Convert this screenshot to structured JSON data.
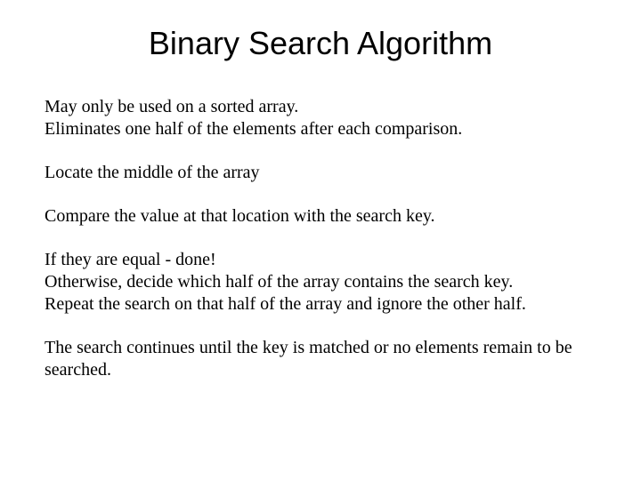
{
  "title": "Binary Search Algorithm",
  "para1": {
    "line1": "May only be used on a sorted array.",
    "line2": "Eliminates one half of the elements after each comparison."
  },
  "para2": "Locate the middle of the array",
  "para3": "Compare the value at that location with the search key.",
  "para4": {
    "line1": "If they are equal - done!",
    "line2": "Otherwise, decide which half of the array contains the search key.",
    "line3": "Repeat the search on that half of the array and ignore the other half."
  },
  "para5": "The search continues until the key is matched or no elements remain to be searched."
}
